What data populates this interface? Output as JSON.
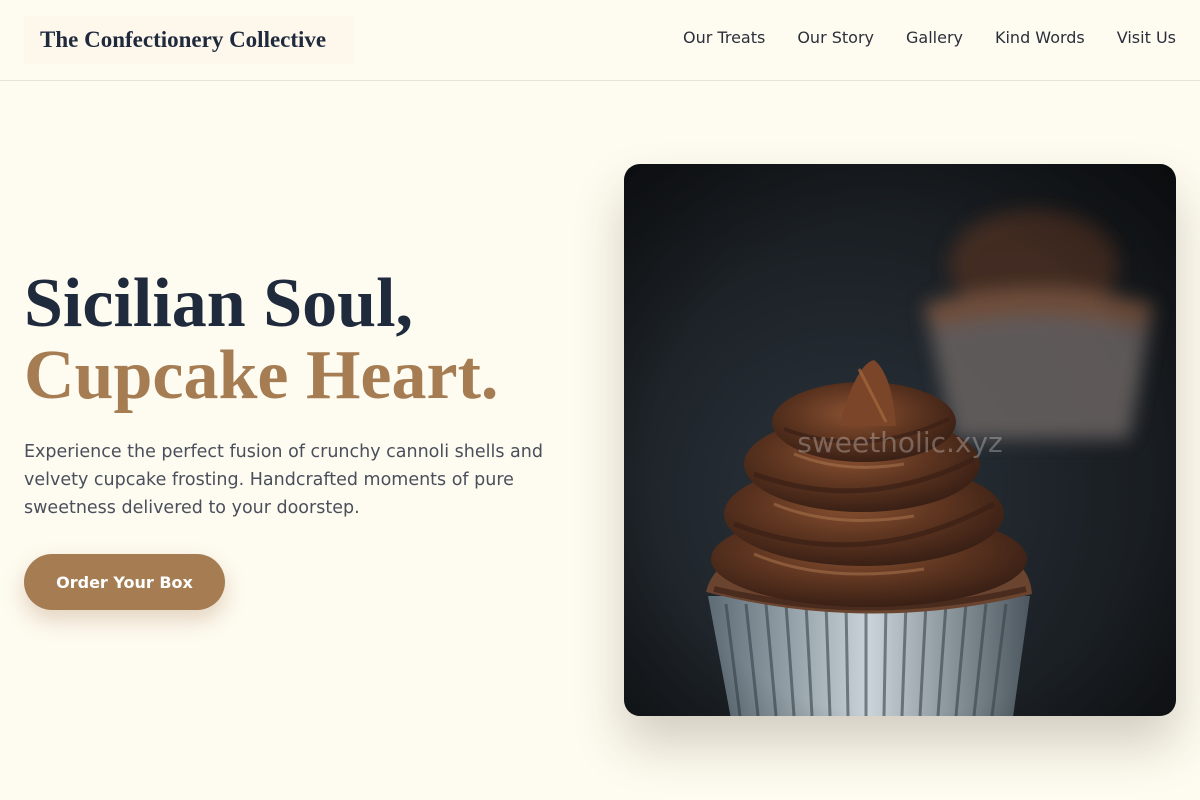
{
  "header": {
    "brand": "The Confectionery Collective",
    "nav": [
      "Our Treats",
      "Our Story",
      "Gallery",
      "Kind Words",
      "Visit Us"
    ]
  },
  "hero": {
    "title_line1": "Sicilian Soul,",
    "title_line2": "Cupcake Heart.",
    "description": "Experience the perfect fusion of crunchy cannoli shells and velvety cupcake frosting. Handcrafted moments of pure sweetness delivered to your doorstep.",
    "cta_label": "Order Your Box",
    "image": {
      "subject": "chocolate-frosted cupcake",
      "watermark": "sweetholic.xyz"
    }
  },
  "colors": {
    "background": "#fefbf0",
    "accent": "#a67c52",
    "heading": "#1f2a3d",
    "body_text": "#4a4f5c"
  }
}
